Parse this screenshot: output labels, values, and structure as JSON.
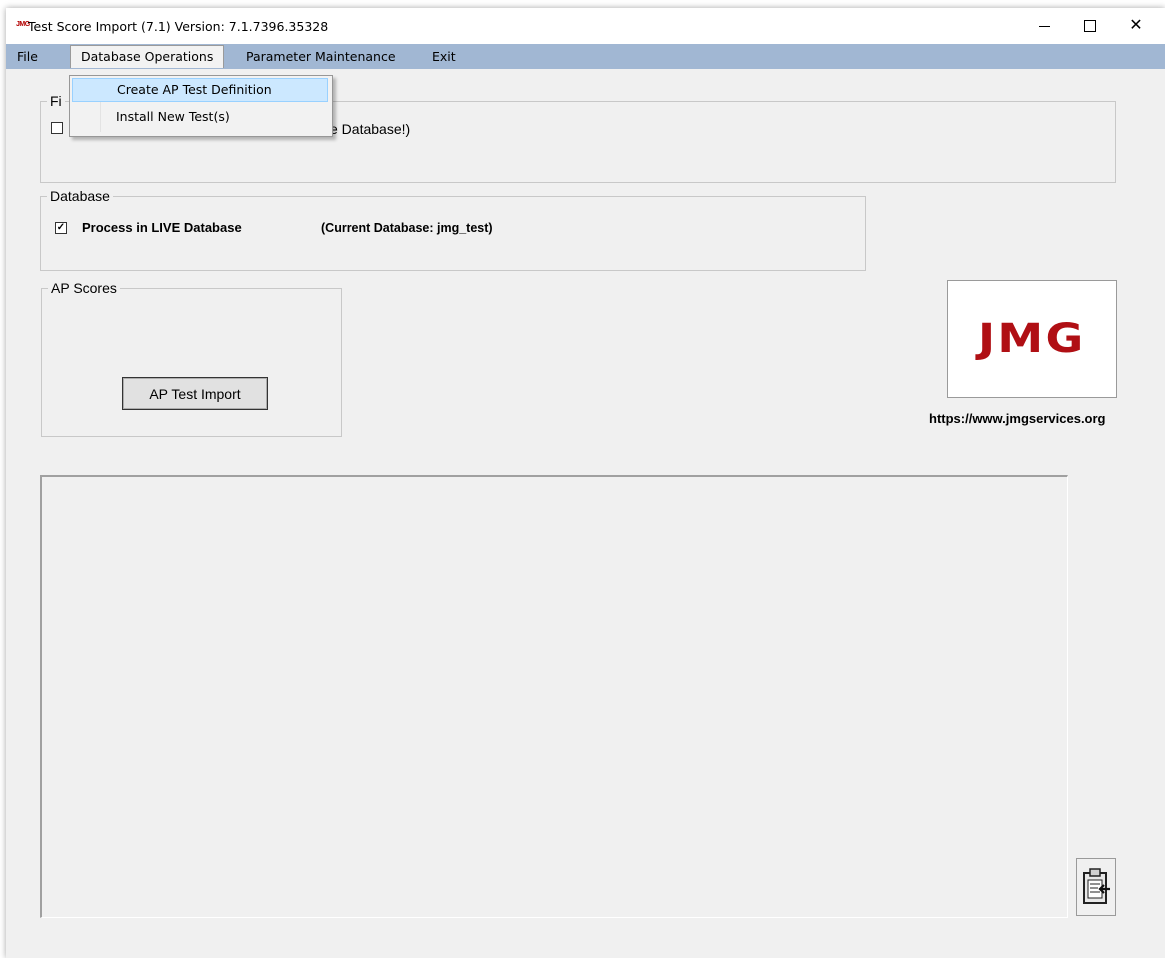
{
  "window": {
    "app_icon_text": "JMG",
    "title": "Test Score Import (7.1) Version: 7.1.7396.35328",
    "minimize_symbol": "",
    "close_symbol": "✕"
  },
  "menubar": {
    "file": "File",
    "database_operations": "Database Operations",
    "parameter_maintenance": "Parameter Maintenance",
    "exit": "Exit"
  },
  "dropdown": {
    "items": [
      {
        "label": "Create AP Test Definition"
      },
      {
        "label": "Install New Test(s)"
      }
    ]
  },
  "file_group": {
    "legend": "Fi",
    "visible_text": "e Database!)"
  },
  "database_group": {
    "legend": "Database",
    "live_checkbox_checked": true,
    "live_checkbox_mark": "✓",
    "live_label": "Process in LIVE Database",
    "current_database": "(Current Database: jmg_test)"
  },
  "ap_scores_group": {
    "legend": "AP Scores",
    "import_button": "AP Test Import"
  },
  "logo": {
    "text": "JMG",
    "url": "https://www.jmgservices.org",
    "color": "#b00f14"
  },
  "log_area": {
    "content": ""
  },
  "paste_button": {
    "icon": "clipboard-paste-icon"
  },
  "colors": {
    "menubar": "#a1b7d3",
    "highlight": "#cce8ff",
    "window_bg": "#f0f0f0"
  }
}
